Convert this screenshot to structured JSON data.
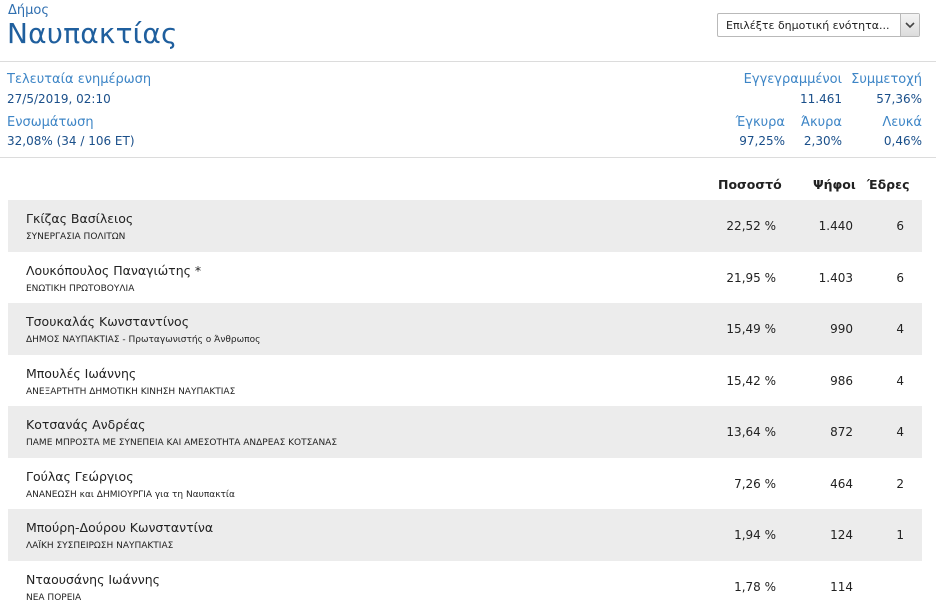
{
  "header": {
    "kicker": "Δήμος",
    "title": "Ναυπακτίας",
    "select_value": "Επιλέξτε δημοτική ενότητα..."
  },
  "stats": {
    "last_update_label": "Τελευταία ενημέρωση",
    "last_update_value": "27/5/2019, 02:10",
    "integration_label": "Ενσωμάτωση",
    "integration_value": "32,08% (34 / 106 ΕΤ)",
    "registered_label": "Εγγεγραμμένοι",
    "registered_value": "11.461",
    "participation_label": "Συμμετοχή",
    "participation_value": "57,36%",
    "valid_label": "Έγκυρα",
    "valid_value": "97,25%",
    "invalid_label": "Άκυρα",
    "invalid_value": "2,30%",
    "blank_label": "Λευκά",
    "blank_value": "0,46%"
  },
  "table": {
    "col_percent": "Ποσοστό",
    "col_votes": "Ψήφοι",
    "col_seats": "Έδρες",
    "rows": [
      {
        "name": "Γκίζας Βασίλειος",
        "party": "ΣΥΝΕΡΓΑΣΙΑ ΠΟΛΙΤΩΝ",
        "percent": "22,52 %",
        "votes": "1.440",
        "seats": "6"
      },
      {
        "name": "Λουκόπουλος Παναγιώτης *",
        "party": "ΕΝΩΤΙΚΗ ΠΡΩΤΟΒΟΥΛΙΑ",
        "percent": "21,95 %",
        "votes": "1.403",
        "seats": "6"
      },
      {
        "name": "Τσουκαλάς Κωνσταντίνος",
        "party": "ΔΗΜΟΣ ΝΑΥΠΑΚΤΙΑΣ - Πρωταγωνιστής ο Άνθρωπος",
        "percent": "15,49 %",
        "votes": "990",
        "seats": "4"
      },
      {
        "name": "Μπουλές Ιωάννης",
        "party": "ΑΝΕΞΑΡΤΗΤΗ ΔΗΜΟΤΙΚΗ ΚΙΝΗΣΗ ΝΑΥΠΑΚΤΙΑΣ",
        "percent": "15,42 %",
        "votes": "986",
        "seats": "4"
      },
      {
        "name": "Κοτσανάς Ανδρέας",
        "party": "ΠΑΜΕ ΜΠΡΟΣΤΑ ΜΕ ΣΥΝΕΠΕΙΑ ΚΑΙ ΑΜΕΣΟΤΗΤΑ ΑΝΔΡΕΑΣ ΚΟΤΣΑΝΑΣ",
        "percent": "13,64 %",
        "votes": "872",
        "seats": "4"
      },
      {
        "name": "Γούλας Γεώργιος",
        "party": "ΑΝΑΝΕΩΣΗ και ΔΗΜΙΟΥΡΓΙΑ για τη Ναυπακτία",
        "percent": "7,26 %",
        "votes": "464",
        "seats": "2"
      },
      {
        "name": "Μπούρη-Δούρου Κωνσταντίνα",
        "party": "ΛΑΪΚΗ ΣΥΣΠΕΙΡΩΣΗ ΝΑΥΠΑΚΤΙΑΣ",
        "percent": "1,94 %",
        "votes": "124",
        "seats": "1"
      },
      {
        "name": "Νταουσάνης Ιωάννης",
        "party": "ΝΕΑ ΠΟΡΕΙΑ",
        "percent": "1,78 %",
        "votes": "114",
        "seats": ""
      }
    ]
  }
}
